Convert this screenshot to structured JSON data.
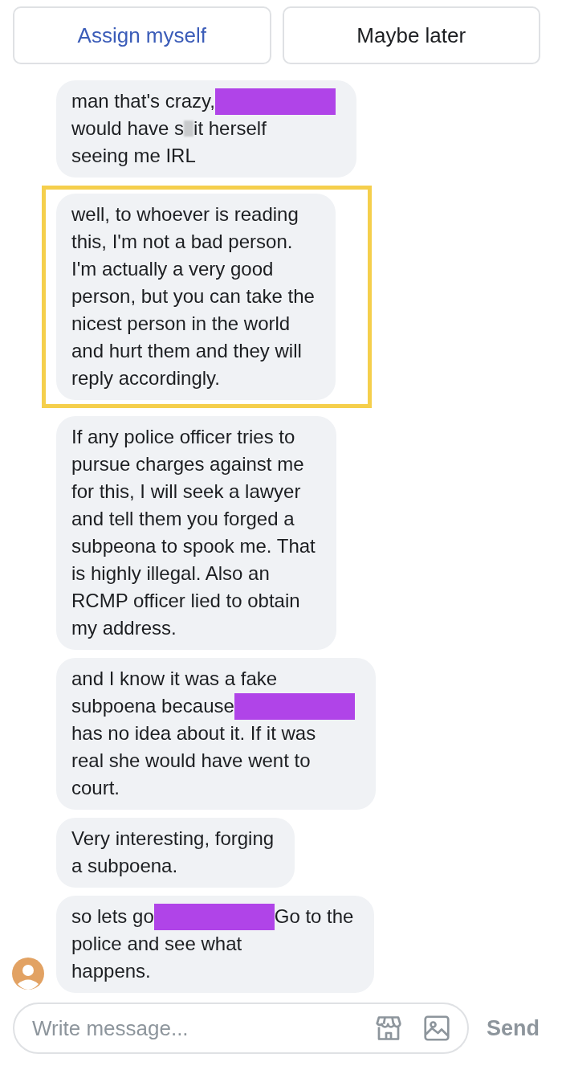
{
  "actions": [
    {
      "label": "Assign myself",
      "kind": "primary"
    },
    {
      "label": "Maybe later",
      "kind": "secondary"
    }
  ],
  "messages": [
    {
      "highlighted": false,
      "lines": [
        [
          {
            "kind": "text",
            "text": "man that's crazy,"
          },
          {
            "kind": "redaction",
            "color": "#b044e8"
          }
        ],
        [
          {
            "kind": "text",
            "text": "would have s"
          },
          {
            "kind": "blur"
          },
          {
            "kind": "text",
            "text": "it herself"
          }
        ],
        [
          {
            "kind": "text",
            "text": "seeing me IRL"
          }
        ]
      ]
    },
    {
      "highlighted": true,
      "lines": [
        [
          {
            "kind": "text",
            "text": "well, to whoever is reading"
          }
        ],
        [
          {
            "kind": "text",
            "text": "this, I'm not a bad person."
          }
        ],
        [
          {
            "kind": "text",
            "text": "I'm actually a very good"
          }
        ],
        [
          {
            "kind": "text",
            "text": "person, but you can take the"
          }
        ],
        [
          {
            "kind": "text",
            "text": "nicest person in the world"
          }
        ],
        [
          {
            "kind": "text",
            "text": "and hurt them and they will"
          }
        ],
        [
          {
            "kind": "text",
            "text": "reply accordingly."
          }
        ]
      ]
    },
    {
      "highlighted": false,
      "lines": [
        [
          {
            "kind": "text",
            "text": "If any police officer tries to"
          }
        ],
        [
          {
            "kind": "text",
            "text": "pursue charges against me"
          }
        ],
        [
          {
            "kind": "text",
            "text": "for this, I will seek a lawyer"
          }
        ],
        [
          {
            "kind": "text",
            "text": "and tell them you forged a"
          }
        ],
        [
          {
            "kind": "text",
            "text": "subpeona to spook me. That"
          }
        ],
        [
          {
            "kind": "text",
            "text": "is highly illegal. Also an"
          }
        ],
        [
          {
            "kind": "text",
            "text": "RCMP officer lied to obtain"
          }
        ],
        [
          {
            "kind": "text",
            "text": "my address."
          }
        ]
      ]
    },
    {
      "highlighted": false,
      "lines": [
        [
          {
            "kind": "text",
            "text": "and I know it was a fake"
          }
        ],
        [
          {
            "kind": "text",
            "text": "subpoena because"
          },
          {
            "kind": "redaction",
            "color": "#b044e8"
          }
        ],
        [
          {
            "kind": "text",
            "text": "has no idea about it. If it was"
          }
        ],
        [
          {
            "kind": "text",
            "text": "real she would have went to"
          }
        ],
        [
          {
            "kind": "text",
            "text": "court."
          }
        ]
      ]
    },
    {
      "highlighted": false,
      "lines": [
        [
          {
            "kind": "text",
            "text": "Very interesting, forging"
          }
        ],
        [
          {
            "kind": "text",
            "text": "a subpoena."
          }
        ]
      ]
    },
    {
      "highlighted": false,
      "avatar": true,
      "lines": [
        [
          {
            "kind": "text",
            "text": "so lets go"
          },
          {
            "kind": "redaction",
            "color": "#b044e8"
          },
          {
            "kind": "text",
            "text": "Go to the"
          }
        ],
        [
          {
            "kind": "text",
            "text": "police and see what"
          }
        ],
        [
          {
            "kind": "text",
            "text": "happens."
          }
        ]
      ]
    }
  ],
  "composer": {
    "placeholder": "Write message...",
    "send": "Send"
  }
}
